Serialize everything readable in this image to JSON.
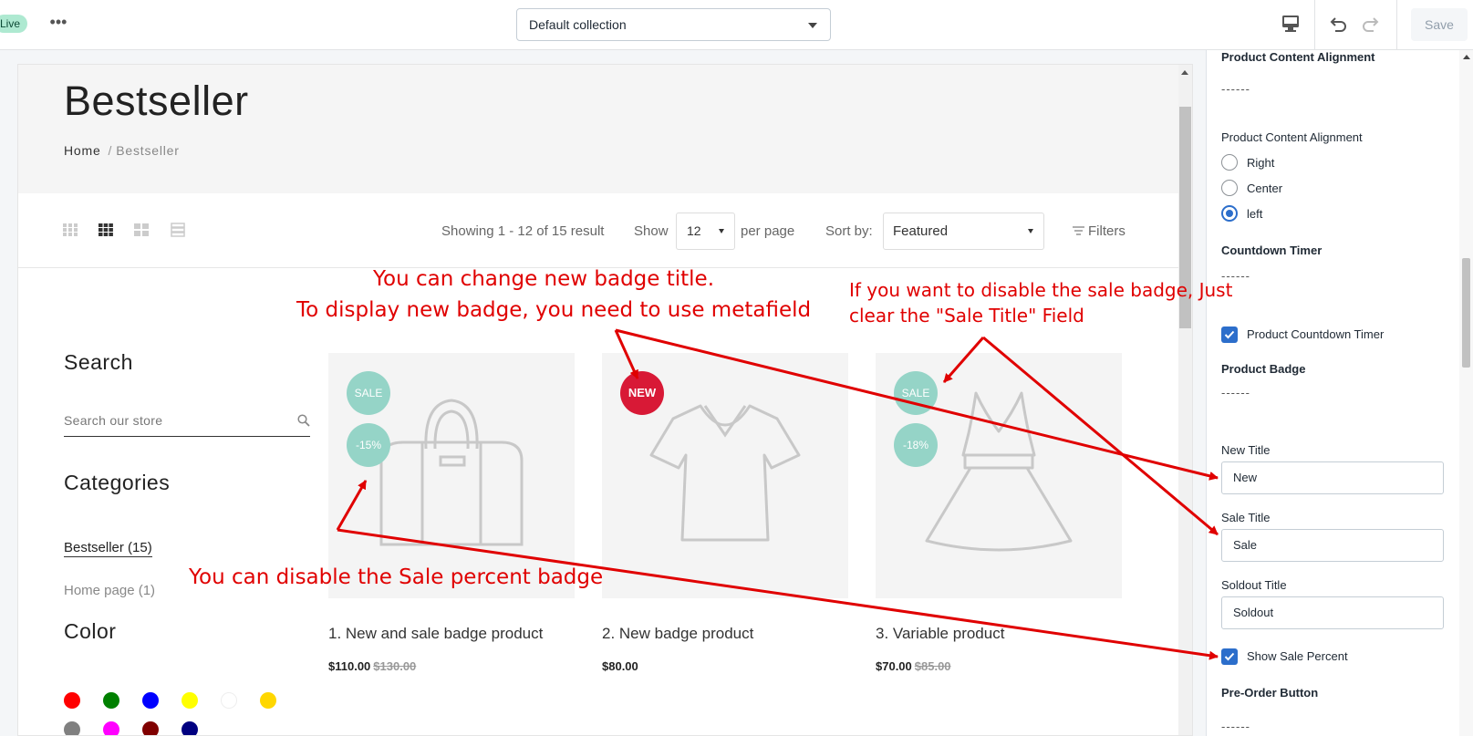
{
  "topbar": {
    "live_label": "Live",
    "more_label": "•••",
    "collection_select": "Default collection",
    "save_label": "Save",
    "icons": [
      "desktop-icon",
      "undo-icon",
      "redo-icon"
    ]
  },
  "preview": {
    "page_title": "Bestseller",
    "breadcrumb": {
      "home": "Home",
      "separator": "/",
      "current": "Bestseller"
    },
    "toolbar": {
      "result_text": "Showing 1 - 12 of 15 result",
      "show_label": "Show",
      "show_value": "12",
      "per_page_label": "per page",
      "sort_label": "Sort by:",
      "sort_value": "Featured",
      "filters_label": "Filters"
    },
    "sidebar": {
      "search_title": "Search",
      "search_placeholder": "Search our store",
      "categories_title": "Categories",
      "categories": [
        "Bestseller (15)",
        "Home page (1)"
      ],
      "color_title": "Color",
      "colors": [
        "#ff0000",
        "#008000",
        "#0000ff",
        "#ffff00",
        "#ffffff",
        "#ffd700",
        "#808080",
        "#ff00ff",
        "#800000",
        "#000080"
      ]
    },
    "products": [
      {
        "name": "1. New and sale badge product",
        "price": "$110.00",
        "old_price": "$130.00",
        "badges": [
          "SALE",
          "-15%"
        ]
      },
      {
        "name": "2. New badge product",
        "price": "$80.00",
        "old_price": "",
        "badges": [
          "NEW"
        ]
      },
      {
        "name": "3. Variable product",
        "price": "$70.00",
        "old_price": "$85.00",
        "badges": [
          "SALE",
          "-18%"
        ]
      }
    ]
  },
  "panel": {
    "heading_alignment": "Product Content Alignment",
    "divider": "------",
    "alignment_label": "Product Content Alignment",
    "alignment_options": [
      "Right",
      "Center",
      "left"
    ],
    "alignment_selected": "left",
    "heading_countdown": "Countdown Timer",
    "countdown_checkbox": "Product Countdown Timer",
    "heading_badge": "Product Badge",
    "new_title_label": "New Title",
    "new_title_value": "New",
    "sale_title_label": "Sale Title",
    "sale_title_value": "Sale",
    "soldout_title_label": "Soldout Title",
    "soldout_title_value": "Soldout",
    "show_sale_percent_label": "Show Sale Percent",
    "heading_preorder": "Pre-Order Button"
  },
  "annotations": {
    "new_badge_line1": "You can change new badge title.",
    "new_badge_line2": "To display new badge, you need to use metafield",
    "sale_badge_line1": "If you want to disable the sale badge, Just",
    "sale_badge_line2": "clear the \"Sale Title\" Field",
    "percent_badge": "You can disable the Sale percent badge",
    "color": "#e00000"
  }
}
